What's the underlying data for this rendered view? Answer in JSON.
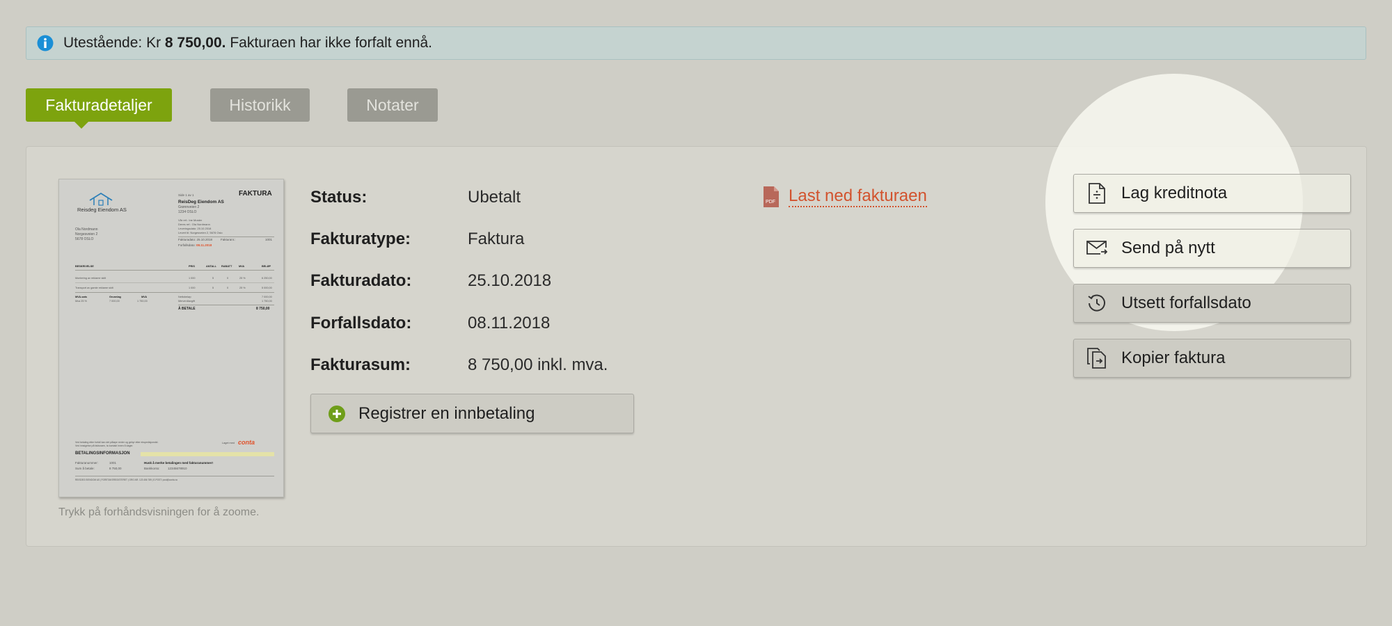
{
  "alert": {
    "icon": "info-icon",
    "prefix": "Utestående: Kr ",
    "amount": "8 750,00.",
    "suffix": " Fakturaen har ikke forfalt ennå."
  },
  "tabs": [
    {
      "label": "Fakturadetaljer",
      "active": true
    },
    {
      "label": "Historikk",
      "active": false
    },
    {
      "label": "Notater",
      "active": false
    }
  ],
  "preview": {
    "caption": "Trykk på forhåndsvisningen for å zoome.",
    "company_logo_text": "Reisdeg Eiendom AS",
    "doc_title": "FAKTURA",
    "page_text": "Side 1 av 1",
    "sender_name": "ReisDeg Eiendom AS",
    "sender_address_1": "Grønnveien 2",
    "sender_address_2": "1234 OSLO",
    "ref_1": "Vår ref.: Ine Moster",
    "ref_2": "Deres ref.: Ola Nordmann",
    "ref_3": "Leveringsdato: 25.10.2018",
    "ref_4": "Levert til: Norgesveien 2, 5678 Oslo",
    "recipient_name": "Ola Nordmann",
    "recipient_address_1": "Norgesveien 2",
    "recipient_address_2": "5678 OSLO",
    "invoice_date_label": "Fakturadato:",
    "invoice_date": "25.10.2018",
    "invoice_no_label": "Fakturanr.:",
    "invoice_no": "1001",
    "due_date_label": "Forfallsdato:",
    "due_date": "08.11.2018",
    "col_desc": "BESKRIVELSE",
    "col_price": "PRIS",
    "col_qty": "ANTALL",
    "col_discount": "RABATT",
    "col_vat": "MVA",
    "col_amount": "BELØP",
    "line_1": [
      "Montering av reklame skilt",
      "1 000",
      "5",
      "0",
      "25 %",
      "6 250,00"
    ],
    "line_2": [
      "Transport av gamle reklame skilt",
      "1 000",
      "5",
      "0",
      "25 %",
      "5 000,00"
    ],
    "vat_head": [
      "MVA-sats",
      "Grunnlag",
      "MVA"
    ],
    "vat_row": [
      "Mva 25 %",
      "7 000,00",
      "1 750,00"
    ],
    "sum_net_label": "Nettobeløp",
    "sum_net": "7 000,00",
    "sum_vat_label": "Merverdiavgift",
    "sum_vat": "1 750,00",
    "sum_total_label": "Å BETALE",
    "sum_total": "8 750,00",
    "footer_note_1": "Ved betaling etter forfall kan det påløpe renter og gebyr etter ekspedisjonstid.",
    "footer_note_2": "Ved innsigelse på fakturaen, ta kontakt innen 8 dager.",
    "made_with": "Laget med",
    "brand": "conta",
    "payment_heading": "BETALINGSINFORMASJON",
    "pay_invoice_no_label": "Fakturanummer:",
    "pay_invoice_no": "1001",
    "pay_sum_label": "Sum å betale:",
    "pay_sum": "8 750,00",
    "pay_note": "Husk å merke betalingen med fakturanummer!",
    "pay_account_label": "Bankkonto:",
    "pay_account": "12345678910",
    "footer_company": "REISDEG EIENDOM AS | FORETAKSREGISTERET | ORG.NR. 123 456 789 | E-POST: post@conta.no"
  },
  "details": [
    {
      "label": "Status:",
      "value": "Ubetalt"
    },
    {
      "label": "Fakturatype:",
      "value": "Faktura"
    },
    {
      "label": "Fakturadato:",
      "value": "25.10.2018"
    },
    {
      "label": "Forfallsdato:",
      "value": "08.11.2018"
    },
    {
      "label": "Fakturasum:",
      "value": "8 750,00 inkl. mva."
    }
  ],
  "download": {
    "icon": "pdf-file-icon",
    "icon_text": "PDF",
    "label": "Last ned fakturaen"
  },
  "register_payment": {
    "icon": "plus-circle-icon",
    "label": "Registrer en innbetaling"
  },
  "actions": [
    {
      "icon": "credit-note-icon",
      "label": "Lag kreditnota"
    },
    {
      "icon": "mail-send-icon",
      "label": "Send på nytt"
    },
    {
      "icon": "postpone-icon",
      "label": "Utsett forfallsdato"
    },
    {
      "icon": "copy-document-icon",
      "label": "Kopier faktura"
    }
  ],
  "colors": {
    "background": "#cfcec6",
    "tab_active": "#7da30e",
    "tab_inactive": "#9a9a92",
    "link": "#d2532e",
    "info": "#1a8fd6",
    "due_highlight": "#e0512a"
  }
}
